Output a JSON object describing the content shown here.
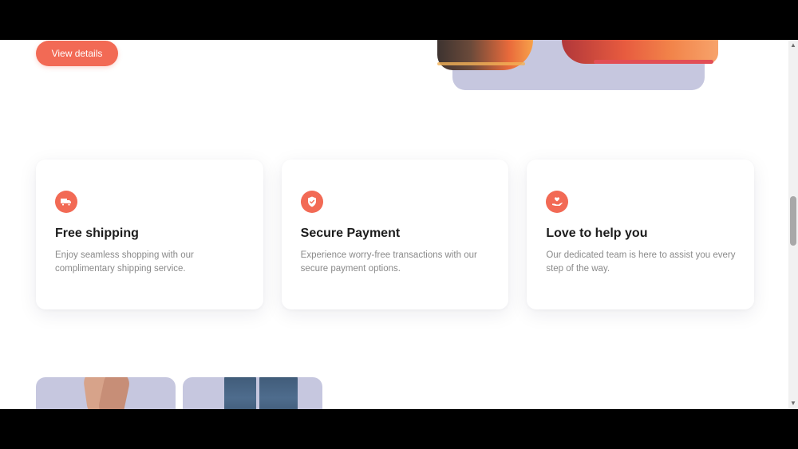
{
  "hero": {
    "button_label": "View details"
  },
  "features": [
    {
      "icon": "truck-icon",
      "title": "Free shipping",
      "description": "Enjoy seamless shopping with our complimentary shipping service."
    },
    {
      "icon": "shield-icon",
      "title": "Secure Payment",
      "description": "Experience worry-free transactions with our secure payment options."
    },
    {
      "icon": "hand-heart-icon",
      "title": "Love to help you",
      "description": "Our dedicated team is here to assist you every step of the way."
    }
  ],
  "colors": {
    "accent": "#f26a55",
    "image_bg": "#c6c7df",
    "title_text": "#1c1c1c",
    "body_text": "#8a8a8a"
  },
  "scrollbar": {
    "up_glyph": "▲",
    "down_glyph": "▼"
  }
}
